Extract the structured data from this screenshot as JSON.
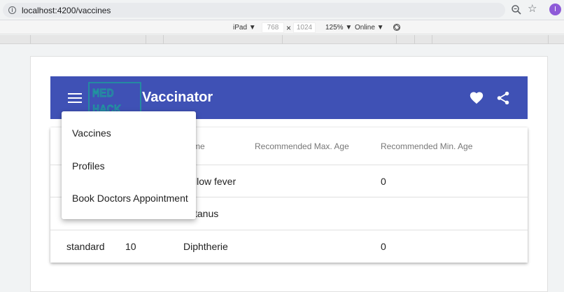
{
  "browser": {
    "url": "localhost:4200/vaccines",
    "profile_initial": "I"
  },
  "device_toolbar": {
    "device": "iPad ▼",
    "width": "768",
    "separator": "×",
    "height": "1024",
    "zoom": "125% ▼",
    "network": "Online ▼"
  },
  "app": {
    "title": "Vaccinator",
    "logo_text": [
      "MED",
      "HACK"
    ]
  },
  "colors": {
    "primary": "#3f51b5",
    "avatar": "#8e5bd8"
  },
  "table": {
    "headers": [
      "me",
      "Recommended Max. Age",
      "Recommended Min. Age"
    ],
    "rows": [
      {
        "type": "",
        "number": "",
        "name": "llow fever",
        "max_age": "",
        "min_age": "0"
      },
      {
        "type": "",
        "number": "",
        "name": "tanus",
        "max_age": "",
        "min_age": ""
      },
      {
        "type": "standard",
        "number": "10",
        "name": "Diphtherie",
        "max_age": "",
        "min_age": "0"
      }
    ]
  },
  "menu": {
    "items": [
      "Vaccines",
      "Profiles",
      "Book Doctors Appointment"
    ]
  }
}
